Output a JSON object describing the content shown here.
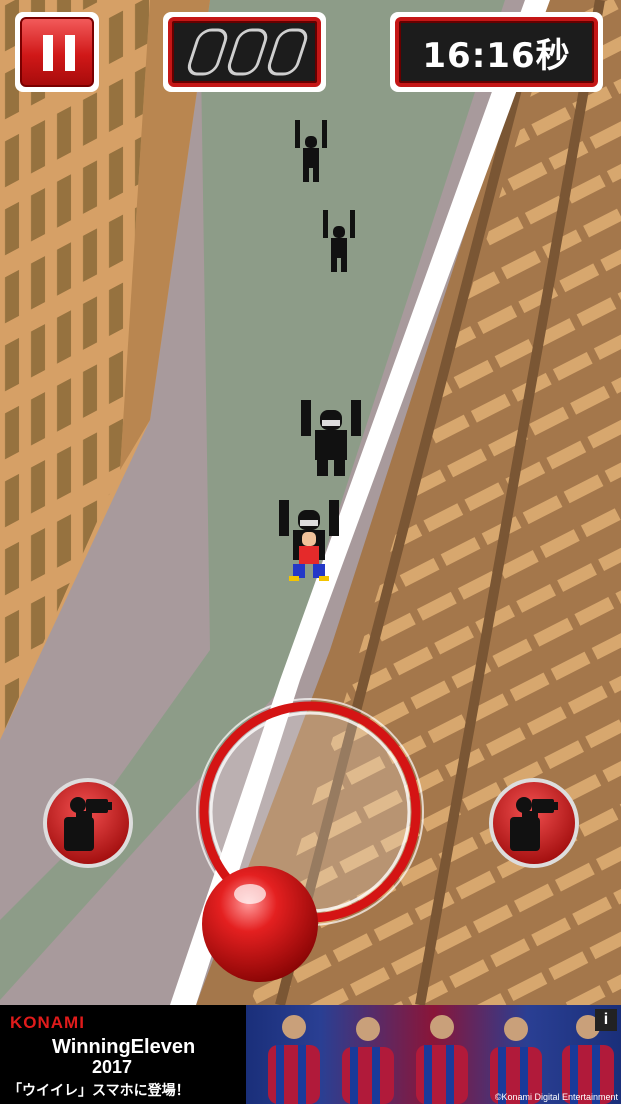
{
  "hud": {
    "pause_icon": "pause-icon",
    "lives_icon": "capsule-slots-icon",
    "timer": "16:16秒"
  },
  "controls": {
    "left_camera_icon": "photographer-icon",
    "right_camera_icon": "photographer-icon",
    "joystick_icon": "joystick-ball-icon"
  },
  "ad": {
    "brand": "KONAMI",
    "title": "WinningEleven",
    "year": "2017",
    "tagline": "「ウイイレ」スマホに登場！",
    "copyright": "©Konami Digital Entertainment",
    "info_icon": "info-icon",
    "info_label": "i"
  },
  "colors": {
    "accent": "#d01818",
    "building": "#d6a066",
    "road": "#a89a9c",
    "sidewalk": "#8d9c88",
    "railway_ground": "#a4774b"
  }
}
